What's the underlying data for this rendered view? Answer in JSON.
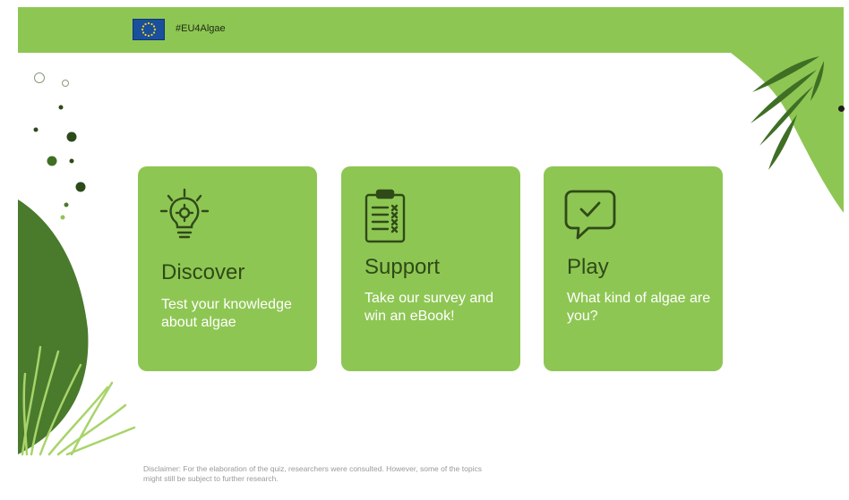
{
  "header": {
    "hashtag": "#EU4Algae",
    "flag_icon": "eu-flag-icon"
  },
  "colors": {
    "accent": "#8ec653",
    "card": "#8ec653",
    "dark_green": "#4a7a2c",
    "title_text": "#2f4a18"
  },
  "cards": [
    {
      "icon": "lightbulb-gear-icon",
      "title": "Discover",
      "description": "Test your knowledge about algae"
    },
    {
      "icon": "clipboard-checklist-icon",
      "title": "Support",
      "description": "Take our survey and win an eBook!"
    },
    {
      "icon": "chat-check-icon",
      "title": "Play",
      "description": "What kind of algae are you?"
    }
  ],
  "footer": {
    "disclaimer": "Disclaimer: For the elaboration of the quiz, researchers were consulted. However, some of the topics might still be subject to further research."
  }
}
